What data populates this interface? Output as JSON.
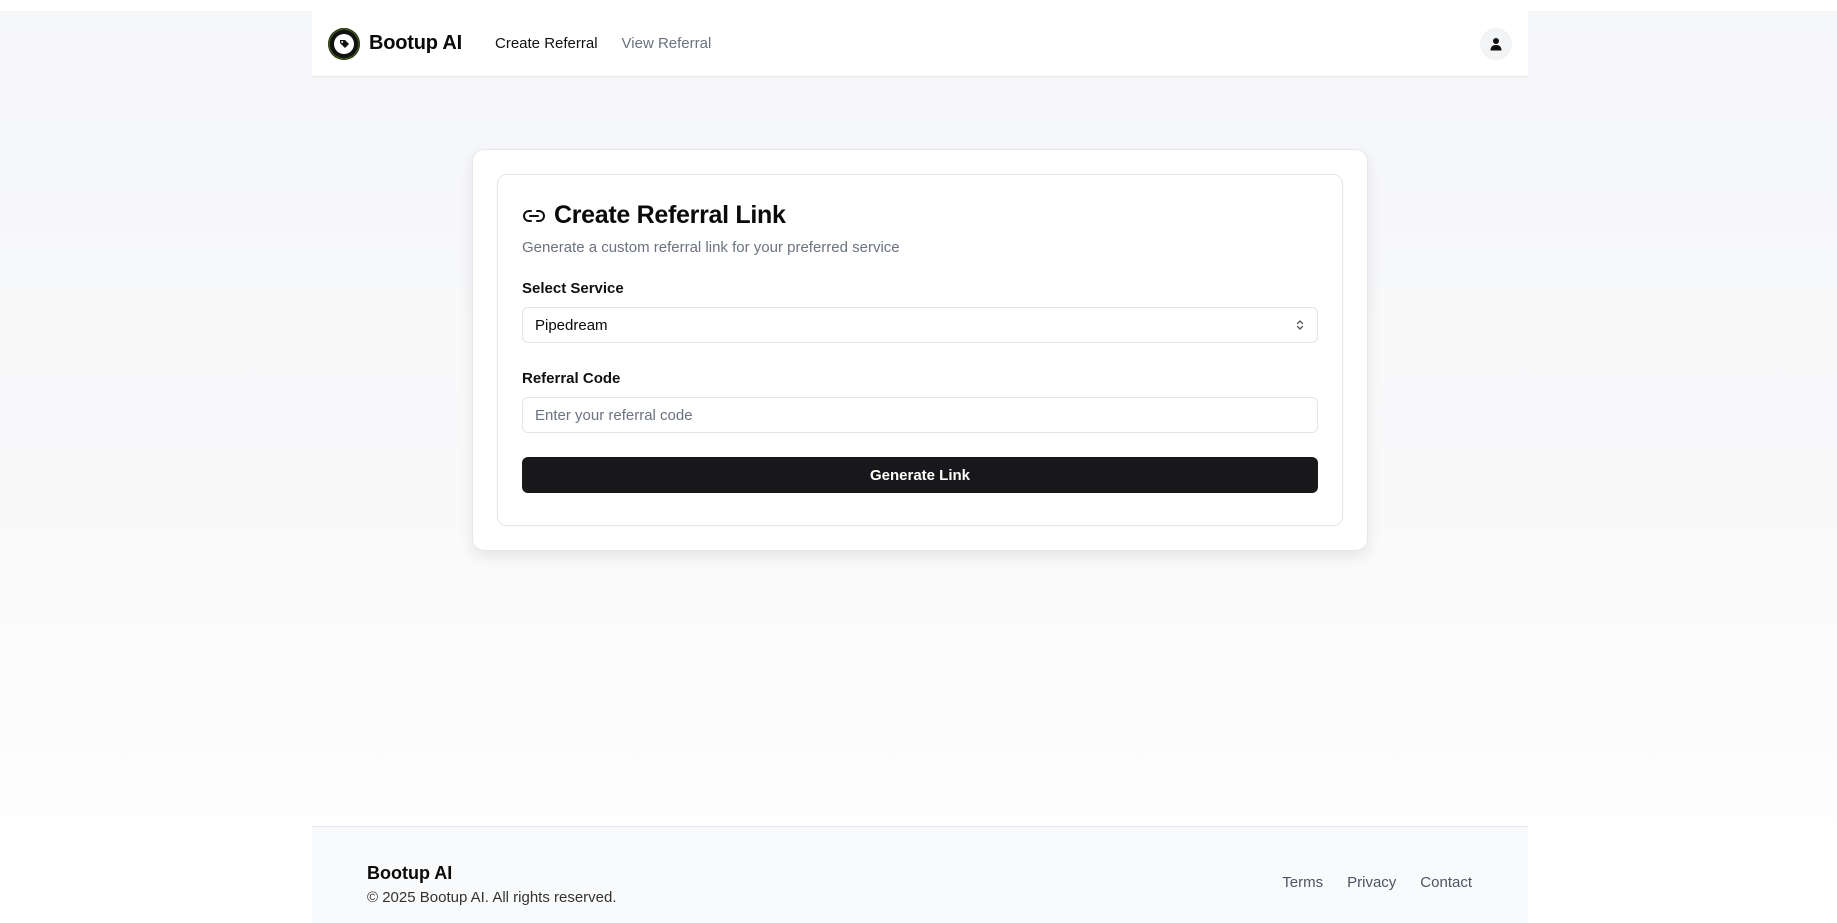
{
  "header": {
    "brand": "Bootup AI",
    "nav": [
      {
        "label": "Create Referral"
      },
      {
        "label": "View Referral"
      }
    ]
  },
  "card": {
    "title": "Create Referral Link",
    "subtitle": "Generate a custom referral link for your preferred service",
    "service_label": "Select Service",
    "service_value": "Pipedream",
    "code_label": "Referral Code",
    "code_placeholder": "Enter your referral code",
    "code_value": "",
    "button_label": "Generate Link"
  },
  "footer": {
    "brand": "Bootup AI",
    "copyright": "© 2025 Bootup AI. All rights reserved.",
    "links": [
      {
        "label": "Terms"
      },
      {
        "label": "Privacy"
      },
      {
        "label": "Contact"
      }
    ]
  },
  "icons": {
    "logo": "logo-icon",
    "user": "user-icon",
    "link": "link-icon",
    "select_chevron": "chevron-up-down-icon"
  }
}
